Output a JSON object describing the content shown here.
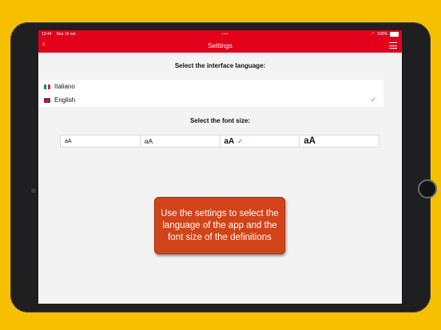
{
  "status_bar": {
    "time": "13:44",
    "date": "Mar 16 set",
    "dots": "•••",
    "battery_pct": "100%"
  },
  "nav": {
    "title": "Settings",
    "back_glyph": "‹"
  },
  "language_section": {
    "title": "Select the interface language:",
    "items": [
      {
        "label": "Italiano",
        "flag": "italy-flag",
        "selected": false
      },
      {
        "label": "English",
        "flag": "uk-flag",
        "selected": true
      }
    ],
    "check_glyph": "✓"
  },
  "font_section": {
    "title": "Select the font size:",
    "options": [
      {
        "label": "aA",
        "size": "small",
        "selected": false
      },
      {
        "label": "aA",
        "size": "medium",
        "selected": false
      },
      {
        "label": "aA",
        "size": "large",
        "selected": true
      },
      {
        "label": "aA",
        "size": "extra-large",
        "selected": false
      }
    ],
    "check_glyph": "✓"
  },
  "callout": {
    "text": "Use the settings to select the language of the app and the font size of the definitions"
  },
  "colors": {
    "accent": "#e3001b",
    "background": "#f6c000",
    "callout": "#d1441a",
    "check": "#4caf50"
  }
}
